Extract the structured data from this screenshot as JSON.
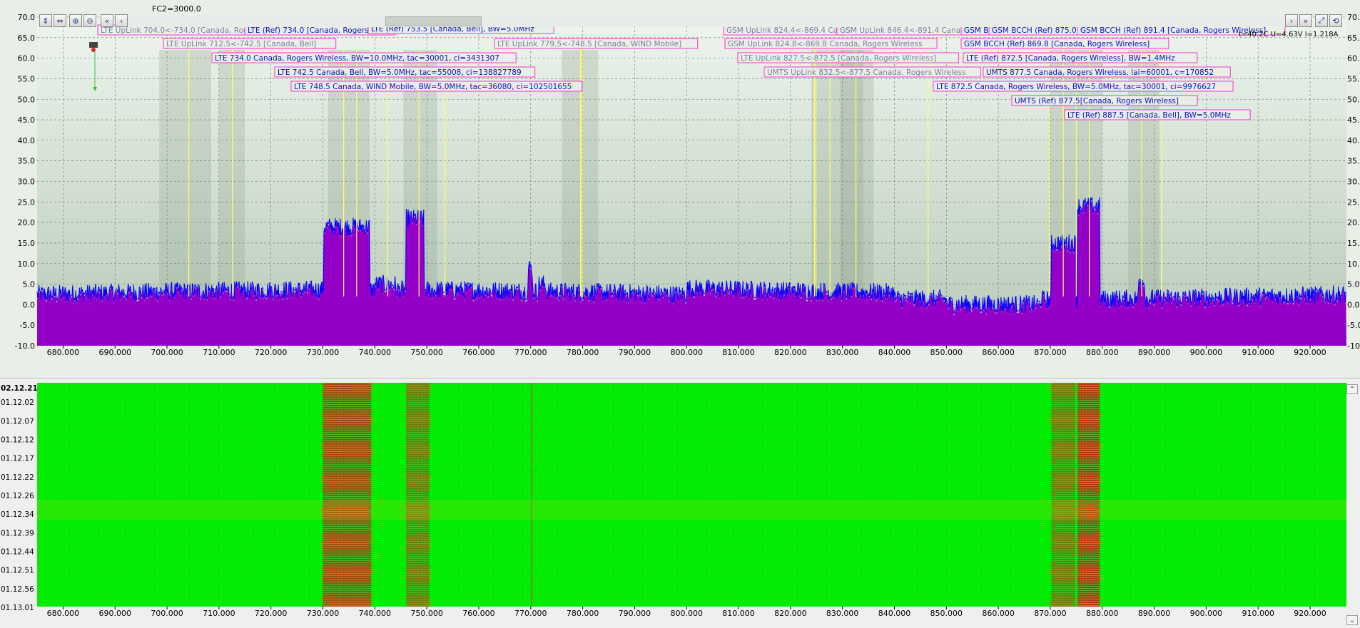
{
  "header": {
    "fc_label": "FC2=3000.0",
    "status_readout": "t=40.2C U=4.63V I=1.218A"
  },
  "toolbar": {
    "buttons": [
      {
        "name": "zoom-fit-y-button",
        "glyph": "⇕"
      },
      {
        "name": "zoom-fit-x-button",
        "glyph": "⇔"
      },
      {
        "name": "zoom-in-button",
        "glyph": "⊕"
      },
      {
        "name": "zoom-out-button",
        "glyph": "⊖"
      },
      {
        "name": "scroll-left-fast-button",
        "glyph": "«"
      },
      {
        "name": "scroll-left-button",
        "glyph": "‹"
      }
    ],
    "right_buttons": [
      {
        "name": "scroll-right-button",
        "glyph": "›"
      },
      {
        "name": "scroll-right-fast-button",
        "glyph": "»"
      },
      {
        "name": "expand-button",
        "glyph": "⤢"
      },
      {
        "name": "reset-button",
        "glyph": "⟲"
      }
    ]
  },
  "spectrum": {
    "x_min": 675,
    "x_max": 927,
    "y_min": -10,
    "y_max": 70,
    "x_ticks": [
      "680.000",
      "690.000",
      "700.000",
      "710.000",
      "720.000",
      "730.000",
      "740.000",
      "750.000",
      "760.000",
      "770.000",
      "780.000",
      "790.000",
      "800.000",
      "810.000",
      "820.000",
      "830.000",
      "840.000",
      "850.000",
      "860.000",
      "870.000",
      "880.000",
      "890.000",
      "900.000",
      "910.000",
      "920.000"
    ],
    "y_ticks": [
      "70.0",
      "65.0",
      "60.0",
      "55.0",
      "50.0",
      "45.0",
      "40.0",
      "35.0",
      "30.0",
      "25.0",
      "20.0",
      "15.0",
      "10.0",
      "5.0",
      "0.0",
      "-5.0",
      "-10.0"
    ],
    "colors": {
      "trace": "#0000ff",
      "fill": "#9400c8",
      "marker_line": "#ffff66",
      "label_border": "#ff33cc",
      "label_text_active": "#1010c0",
      "label_text_dim": "#8080a0"
    },
    "bands": [
      {
        "from": 730.2,
        "to": 739.0,
        "level": 19
      },
      {
        "from": 740.0,
        "to": 744.0,
        "level": 5
      },
      {
        "from": 746.0,
        "to": 749.5,
        "level": 21
      },
      {
        "from": 870.2,
        "to": 875.0,
        "level": 15
      },
      {
        "from": 875.2,
        "to": 879.5,
        "level": 24
      }
    ],
    "shaded_regions": [
      {
        "from": 698.5,
        "to": 708.5
      },
      {
        "from": 710,
        "to": 715
      },
      {
        "from": 731,
        "to": 739
      },
      {
        "from": 745.5,
        "to": 752
      },
      {
        "from": 776,
        "to": 783
      },
      {
        "from": 824,
        "to": 834
      },
      {
        "from": 829.5,
        "to": 836
      },
      {
        "from": 870,
        "to": 880
      },
      {
        "from": 885,
        "to": 891
      }
    ],
    "marker_lines": [
      704.2,
      712.6,
      734.0,
      736.5,
      742.5,
      748.5,
      753.5,
      779.6,
      779.9,
      824.6,
      824.9,
      827.6,
      832.6,
      846.5,
      869.8,
      872.5,
      875.0,
      877.5,
      887.6,
      891.4
    ],
    "labels": [
      {
        "text": "LTE UpLink 704.0<-734.0 [Canada, Rogers W",
        "dim": true
      },
      {
        "text": "LTE (Ref) 734.0 [Canada, Rogers W",
        "dim": false
      },
      {
        "text": "LTE (Ref) 753.5 [Canada, Bell], BW=5.0MHz",
        "dim": false
      },
      {
        "text": "LTE UpLink 712.5<-742.5 [Canada, Bell]",
        "dim": true
      },
      {
        "text": "LTE 734.0 Canada, Rogers Wireless, BW=10.0MHz, tac=30001, ci=3431307",
        "dim": false
      },
      {
        "text": "LTE UpLink 779.5<-748.5 [Canada, WIND Mobile]",
        "dim": true
      },
      {
        "text": "LTE 742.5 Canada, Bell, BW=5.0MHz, tac=55008, ci=138827789",
        "dim": false
      },
      {
        "text": "LTE 748.5 Canada, WIND Mobile, BW=5.0MHz, tac=36080, ci=102501655",
        "dim": false
      },
      {
        "text": "GSM UpLink 824.4<-869.4 Canad",
        "dim": true
      },
      {
        "text": "GSM UpLink 846.4<-891.4 Canada",
        "dim": true
      },
      {
        "text": "GSM BC",
        "dim": false
      },
      {
        "text": "GSM BCCH (Ref) 875.0 [C",
        "dim": false
      },
      {
        "text": "GSM BCCH (Ref) 891.4 [Canada, Rogers Wireless]",
        "dim": false
      },
      {
        "text": "GSM UpLink 824.8<-869.8 Canada, Rogers Wireless",
        "dim": true
      },
      {
        "text": "GSM BCCH (Ref) 869.8 [Canada, Rogers Wireless]",
        "dim": false
      },
      {
        "text": "LTE UpLink 827.5<-872.5 [Canada, Rogers Wireless]",
        "dim": true
      },
      {
        "text": "LTE (Ref) 872.5 [Canada, Rogers Wireless], BW=1.4MHz",
        "dim": false
      },
      {
        "text": "UMTS UpLink 832.5<-877.5 Canada, Rogers Wireless",
        "dim": true
      },
      {
        "text": "UMTS 877.5 Canada, Rogers Wireless, lai=60001, c=170852",
        "dim": false
      },
      {
        "text": "LTE 872.5 Canada, Rogers Wireless, BW=5.0MHz, tac=30001, ci=9976627",
        "dim": false
      },
      {
        "text": "UMTS (Ref) 877.5[Canada, Rogers Wireless]",
        "dim": false
      },
      {
        "text": "LTE (Ref) 887.5 [Canada, Bell], BW=5.0MHz",
        "dim": false
      }
    ]
  },
  "waterfall": {
    "timestamps": [
      "02.12.21",
      "01.12.02",
      "01.12.07",
      "01.12.12",
      "01.12.17",
      "01.12.22",
      "01.12.26",
      "01.12.34",
      "01.12.39",
      "01.12.44",
      "01.12.51",
      "01.12.56",
      "01.13.01"
    ],
    "colors": {
      "background": "#00ee00",
      "signal": "#b02010"
    },
    "signal_bands": [
      {
        "from": 730.0,
        "to": 739.3,
        "intensity": 0.85
      },
      {
        "from": 746.0,
        "to": 750.5,
        "intensity": 0.6
      },
      {
        "from": 770.0,
        "to": 770.4,
        "intensity": 0.4
      },
      {
        "from": 870.2,
        "to": 874.8,
        "intensity": 0.6
      },
      {
        "from": 875.2,
        "to": 879.5,
        "intensity": 0.95
      }
    ]
  }
}
